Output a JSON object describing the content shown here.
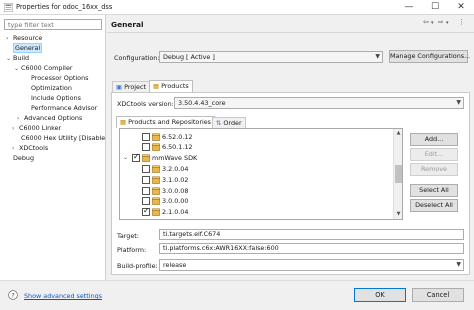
{
  "window": {
    "title": "Properties for odoc_16xx_dss",
    "minimize": "—",
    "maximize": "☐",
    "close": "✕"
  },
  "filter": {
    "placeholder": "type filter text"
  },
  "nav": [
    {
      "label": "Resource",
      "toggle": "›"
    },
    {
      "label": "General",
      "toggle": ""
    },
    {
      "label": "Build",
      "toggle": "⌄"
    },
    {
      "label": "C6000 Compiler",
      "toggle": "⌄"
    },
    {
      "label": "Processor Options",
      "toggle": ""
    },
    {
      "label": "Optimization",
      "toggle": ""
    },
    {
      "label": "Include Options",
      "toggle": ""
    },
    {
      "label": "Performance Advisor",
      "toggle": ""
    },
    {
      "label": "Advanced Options",
      "toggle": "›"
    },
    {
      "label": "C6000 Linker",
      "toggle": "›"
    },
    {
      "label": "C6000 Hex Utility  [Disable",
      "toggle": ""
    },
    {
      "label": "XDCtools",
      "toggle": "›"
    },
    {
      "label": "Debug",
      "toggle": ""
    }
  ],
  "header": {
    "title": "General",
    "back_icon": "⇦",
    "back_menu_icon": "▾",
    "forward_icon": "⇨",
    "forward_menu_icon": "▾",
    "menu_icon": "⋮"
  },
  "configuration": {
    "label": "Configuration:",
    "value": "Debug  [ Active ]",
    "manage_label": "Manage Configurations..."
  },
  "tabs": [
    {
      "label": "Project"
    },
    {
      "label": "Products"
    }
  ],
  "xdctools": {
    "label": "XDCtools version:",
    "value": "3.50.4.43_core"
  },
  "inner_tabs": [
    {
      "label": "Products and Repositories"
    },
    {
      "label": "Order"
    }
  ],
  "products": [
    {
      "label": "6.52.0.12",
      "checked": false,
      "indent": 1
    },
    {
      "label": "6.50.1.12",
      "checked": false,
      "indent": 1
    },
    {
      "label": "mmWave SDK",
      "checked": true,
      "indent": 0
    },
    {
      "label": "3.2.0.04",
      "checked": false,
      "indent": 1
    },
    {
      "label": "3.1.0.02",
      "checked": false,
      "indent": 1
    },
    {
      "label": "3.0.0.08",
      "checked": false,
      "indent": 1
    },
    {
      "label": "3.0.0.00",
      "checked": false,
      "indent": 1
    },
    {
      "label": "2.1.0.04",
      "checked": true,
      "indent": 1
    }
  ],
  "side_buttons": {
    "add": "Add...",
    "edit": "Edit...",
    "remove": "Remove",
    "select_all": "Select All",
    "deselect_all": "Deselect All"
  },
  "target": {
    "label": "Target:",
    "value": "ti.targets.elf.C674"
  },
  "platform": {
    "label": "Platform:",
    "value": "ti.platforms.c6x:AWR16XX:false:600"
  },
  "build_profile": {
    "label": "Build-profile:",
    "value": "release"
  },
  "footer": {
    "help_icon": "?",
    "advanced_link": "Show advanced settings",
    "ok": "OK",
    "cancel": "Cancel"
  },
  "colors": {
    "highlight": "#ffff33",
    "selection": "#cce8ff",
    "link": "#0b56c7"
  }
}
